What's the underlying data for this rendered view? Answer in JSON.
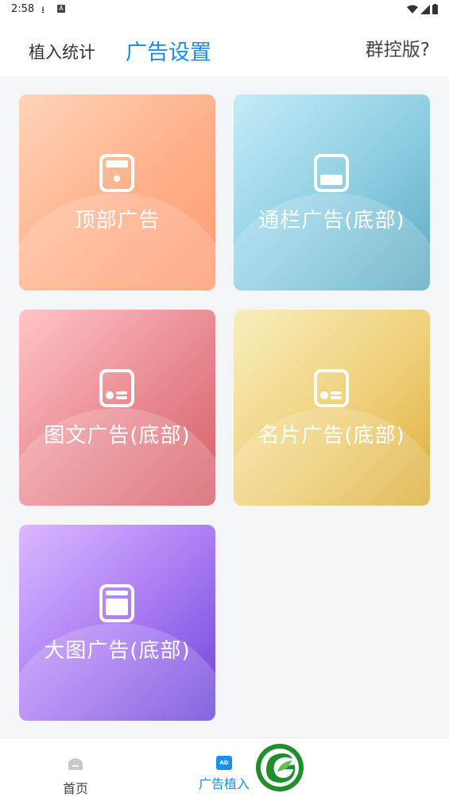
{
  "status_bar": {
    "time": "2:58",
    "left_icons": [
      "download-icon",
      "a-icon"
    ],
    "right_icons": [
      "wifi-icon",
      "signal-icon",
      "battery-icon"
    ]
  },
  "header": {
    "tab_stats": "植入统计",
    "tab_settings": "广告设置",
    "group_version": "群控版?",
    "active_color": "#1a8ff0"
  },
  "cards": [
    {
      "label": "顶部广告",
      "icon": "top-ad-icon",
      "gradient": [
        "#ffd4b8",
        "#ff9a70"
      ]
    },
    {
      "label": "通栏广告(底部)",
      "icon": "banner-ad-icon",
      "gradient": [
        "#c4ecf7",
        "#5fa9c0"
      ]
    },
    {
      "label": "图文广告(底部)",
      "icon": "image-text-ad-icon",
      "gradient": [
        "#ffc4c8",
        "#d45f66"
      ]
    },
    {
      "label": "名片广告(底部)",
      "icon": "card-ad-icon",
      "gradient": [
        "#f8eebc",
        "#dcae3a"
      ]
    },
    {
      "label": "大图广告(底部)",
      "icon": "big-image-ad-icon",
      "gradient": [
        "#dcb8ff",
        "#6b45d8"
      ]
    }
  ],
  "bottom_nav": {
    "home_label": "首页",
    "ad_label": "广告植入",
    "ad_icon_text": "AD",
    "logo": "green-leaf-logo"
  }
}
